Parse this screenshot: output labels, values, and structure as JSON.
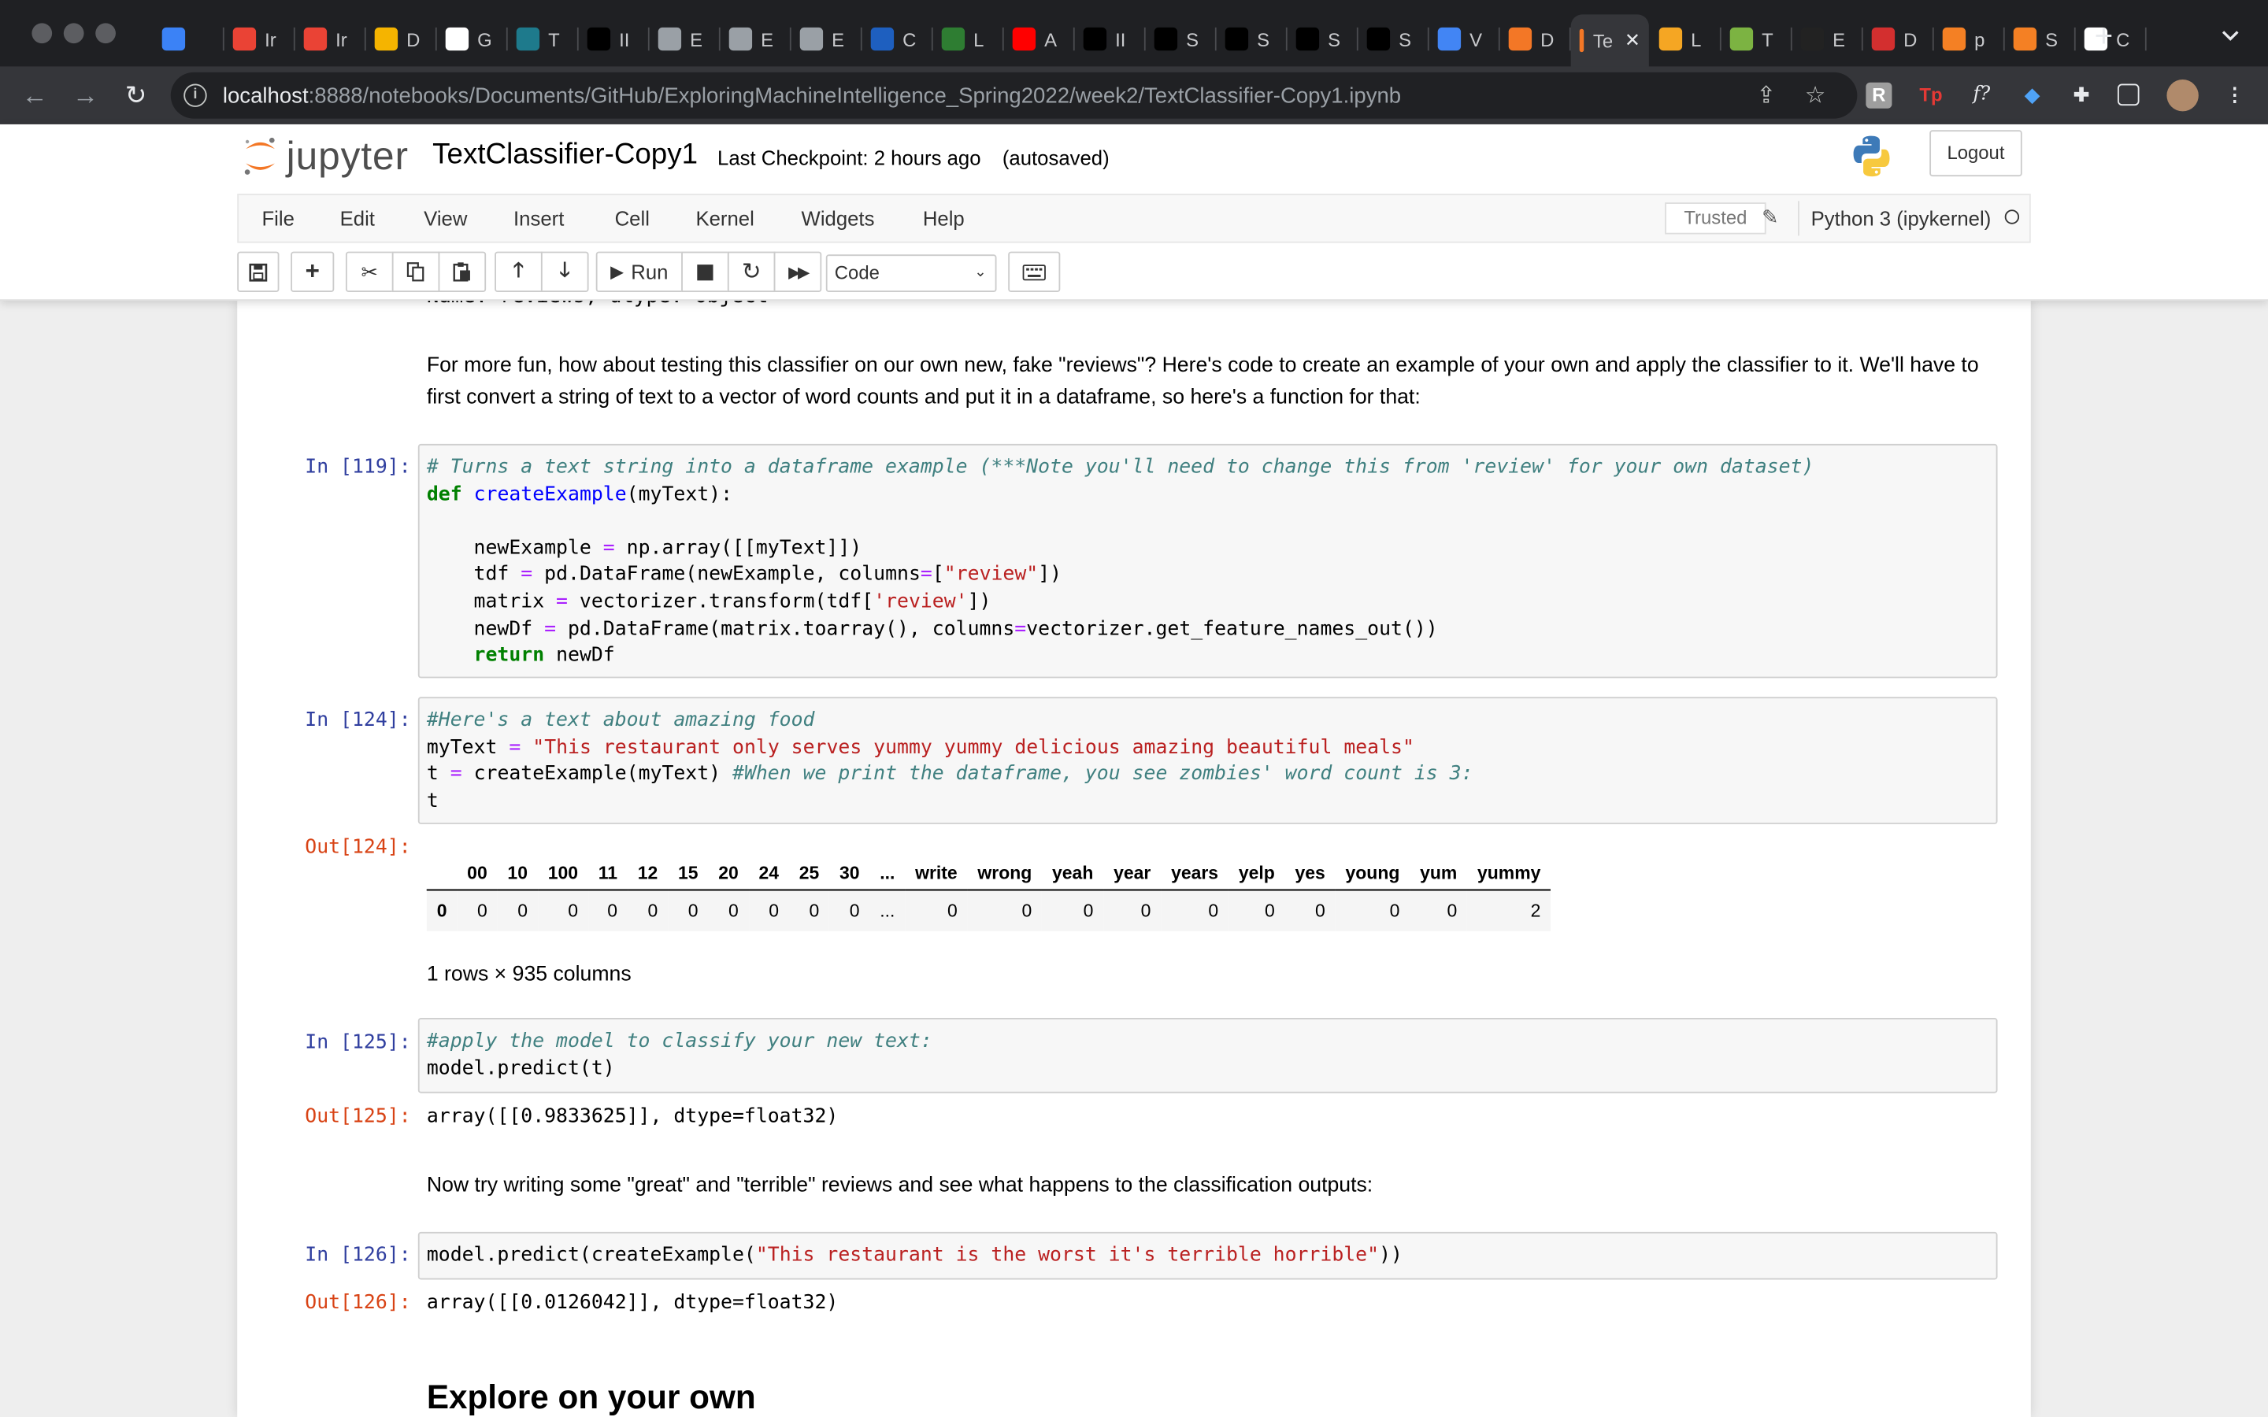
{
  "browser": {
    "tabs": [
      {
        "letter": "",
        "color": "#3b82f6",
        "icon": "gem-icon"
      },
      {
        "letter": "Ir",
        "color": "#ea4335",
        "icon": "gmail-icon"
      },
      {
        "letter": "Ir",
        "color": "#ea4335",
        "icon": "gmail-icon"
      },
      {
        "letter": "D",
        "color": "#f5b400",
        "icon": "emoji-icon"
      },
      {
        "letter": "G",
        "color": "#ffffff",
        "icon": "github-icon"
      },
      {
        "letter": "T",
        "color": "#1e7a8c",
        "icon": "info-icon"
      },
      {
        "letter": "II",
        "color": "#000000",
        "icon": "dots-icon"
      },
      {
        "letter": "E",
        "color": "#9aa0a6",
        "icon": "globe-icon"
      },
      {
        "letter": "E",
        "color": "#9aa0a6",
        "icon": "globe-icon"
      },
      {
        "letter": "E",
        "color": "#9aa0a6",
        "icon": "globe-icon"
      },
      {
        "letter": "C",
        "color": "#1e5fbf",
        "icon": "s-icon"
      },
      {
        "letter": "L",
        "color": "#2e7d32",
        "icon": "face-icon"
      },
      {
        "letter": "A",
        "color": "#ff0000",
        "icon": "youtube-icon"
      },
      {
        "letter": "II",
        "color": "#000000",
        "icon": "dots-icon"
      },
      {
        "letter": "S",
        "color": "#000000",
        "icon": "dots-icon"
      },
      {
        "letter": "S",
        "color": "#000000",
        "icon": "dots-icon"
      },
      {
        "letter": "S",
        "color": "#000000",
        "icon": "dots-icon"
      },
      {
        "letter": "S",
        "color": "#000000",
        "icon": "dots-icon"
      },
      {
        "letter": "V",
        "color": "#4285f4",
        "icon": "google-icon"
      },
      {
        "letter": "D",
        "color": "#f37726",
        "icon": "jupyter-icon"
      },
      {
        "letter": "Te",
        "color": "#f37726",
        "icon": "jupyter-icon",
        "active": true
      },
      {
        "letter": "L",
        "color": "#f5a623",
        "icon": "book-icon"
      },
      {
        "letter": "T",
        "color": "#7cb342",
        "icon": "face-icon"
      },
      {
        "letter": "E",
        "color": "#222222",
        "icon": "w-icon"
      },
      {
        "letter": "D",
        "color": "#d32f2f",
        "icon": "s-red-icon"
      },
      {
        "letter": "p",
        "color": "#f48024",
        "icon": "stackoverflow-icon"
      },
      {
        "letter": "S",
        "color": "#f48024",
        "icon": "stackoverflow-icon"
      },
      {
        "letter": "C",
        "color": "#ffffff",
        "icon": "github-icon"
      }
    ],
    "active_tab_close": "✕",
    "new_tab": "+",
    "url_host": "localhost",
    "url_path": ":8888/notebooks/Documents/GitHub/ExploringMachineIntelligence_Spring2022/week2/TextClassifier-Copy1.ipynb"
  },
  "header": {
    "logo_text": "jupyter",
    "notebook_name": "TextClassifier-Copy1",
    "checkpoint": "Last Checkpoint: 2 hours ago",
    "autosave": "(autosaved)",
    "logout": "Logout"
  },
  "menu": {
    "items": [
      "File",
      "Edit",
      "View",
      "Insert",
      "Cell",
      "Kernel",
      "Widgets",
      "Help"
    ],
    "trusted": "Trusted",
    "kernel": "Python 3 (ipykernel)"
  },
  "toolbar": {
    "run_label": "Run",
    "cell_type": "Code"
  },
  "notebook": {
    "prev_output_cutoff": "Name: reviews, dtype: object",
    "md1": "For more fun, how about testing this classifier on our own new, fake \"reviews\"? Here's code to create an example of your own and apply the classifier to it. We'll have to first convert a string of text to a vector of word counts and put it in a dataframe, so here's a function for that:",
    "cell119_prompt": "In [119]:",
    "cell124_prompt": "In [124]:",
    "out124_prompt": "Out[124]:",
    "df_columns": [
      "",
      "00",
      "10",
      "100",
      "11",
      "12",
      "15",
      "20",
      "24",
      "25",
      "30",
      "...",
      "write",
      "wrong",
      "yeah",
      "year",
      "years",
      "yelp",
      "yes",
      "young",
      "yum",
      "yummy"
    ],
    "df_row": [
      "0",
      "0",
      "0",
      "0",
      "0",
      "0",
      "0",
      "0",
      "0",
      "0",
      "0",
      "...",
      "0",
      "0",
      "0",
      "0",
      "0",
      "0",
      "0",
      "0",
      "0",
      "2"
    ],
    "df_shape": "1 rows × 935 columns",
    "cell125_prompt": "In [125]:",
    "out125_prompt": "Out[125]:",
    "out125": "array([[0.9833625]], dtype=float32)",
    "md2": "Now try writing some \"great\" and \"terrible\" reviews and see what happens to the classification outputs:",
    "cell126_prompt": "In [126]:",
    "out126_prompt": "Out[126]:",
    "out126": "array([[0.0126042]], dtype=float32)",
    "heading": "Explore on your own"
  }
}
